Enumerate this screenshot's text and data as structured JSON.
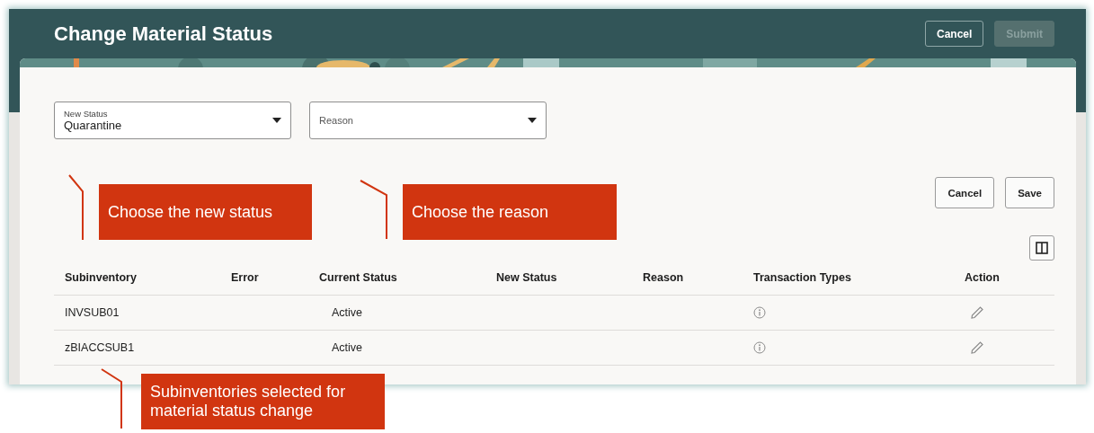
{
  "header": {
    "title": "Change Material Status",
    "buttons": [
      {
        "label": "Cancel",
        "disabled": false
      },
      {
        "label": "Submit",
        "disabled": true
      }
    ]
  },
  "fields": [
    {
      "label": "New Status",
      "value": "Quarantine"
    },
    {
      "placeholder": "Reason"
    }
  ],
  "actions": [
    "Cancel",
    "Save"
  ],
  "table": {
    "columns": [
      "Subinventory",
      "Error",
      "Current Status",
      "New Status",
      "Reason",
      "Transaction Types",
      "Action"
    ],
    "rows": [
      {
        "subinventory": "INVSUB01",
        "current_status": "Active"
      },
      {
        "subinventory": "zBIACCSUB1",
        "current_status": "Active"
      }
    ]
  },
  "callouts": [
    {
      "text": "Choose the new status"
    },
    {
      "text": "Choose the reason"
    },
    {
      "text": "Subinventories selected for material status change"
    }
  ]
}
